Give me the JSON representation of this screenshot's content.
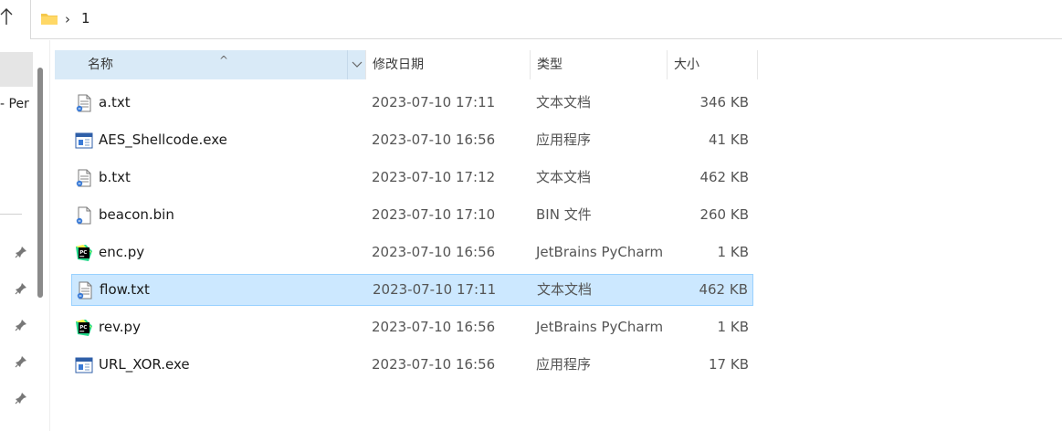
{
  "address_bar": {
    "up_icon": "arrow-up-icon",
    "folder_icon": "folder-icon",
    "separator": "›",
    "path": "1"
  },
  "nav_pane": {
    "partial_label": "- Per",
    "pin_icon": "pin-icon",
    "pins": 5
  },
  "columns": {
    "name": "名称",
    "date": "修改日期",
    "type": "类型",
    "size": "大小",
    "sort_indicator": "^"
  },
  "files": [
    {
      "name": "a.txt",
      "date": "2023-07-10 17:11",
      "type": "文本文档",
      "size": "346 KB",
      "icon": "text-file-icon",
      "selected": false
    },
    {
      "name": "AES_Shellcode.exe",
      "date": "2023-07-10 16:56",
      "type": "应用程序",
      "size": "41 KB",
      "icon": "exe-app-icon",
      "selected": false
    },
    {
      "name": "b.txt",
      "date": "2023-07-10 17:12",
      "type": "文本文档",
      "size": "462 KB",
      "icon": "text-file-icon",
      "selected": false
    },
    {
      "name": "beacon.bin",
      "date": "2023-07-10 17:10",
      "type": "BIN 文件",
      "size": "260 KB",
      "icon": "blank-file-icon",
      "selected": false
    },
    {
      "name": "enc.py",
      "date": "2023-07-10 16:56",
      "type": "JetBrains PyCharm",
      "size": "1 KB",
      "icon": "pycharm-icon",
      "selected": false
    },
    {
      "name": "flow.txt",
      "date": "2023-07-10 17:11",
      "type": "文本文档",
      "size": "462 KB",
      "icon": "text-file-icon",
      "selected": true
    },
    {
      "name": "rev.py",
      "date": "2023-07-10 16:56",
      "type": "JetBrains PyCharm",
      "size": "1 KB",
      "icon": "pycharm-icon",
      "selected": false
    },
    {
      "name": "URL_XOR.exe",
      "date": "2023-07-10 16:56",
      "type": "应用程序",
      "size": "17 KB",
      "icon": "exe-app-icon",
      "selected": false
    }
  ],
  "colors": {
    "header_highlight": "#d9eaf7",
    "selection_fill": "#cce8ff",
    "selection_border": "#99d1ff",
    "folder": "#f5c84c"
  }
}
